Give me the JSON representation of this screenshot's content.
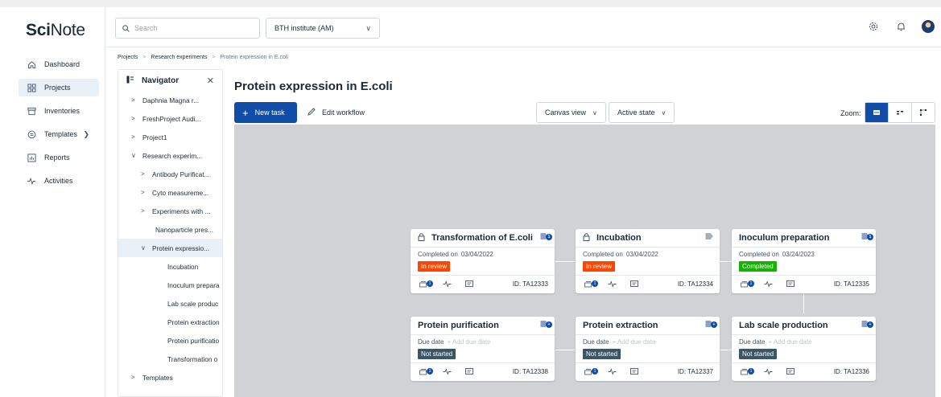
{
  "app": {
    "logo_sci": "Sci",
    "logo_note": "Note"
  },
  "sidebar": {
    "items": [
      {
        "label": "Dashboard",
        "icon": "home-icon"
      },
      {
        "label": "Projects",
        "icon": "projects-icon",
        "active": true
      },
      {
        "label": "Inventories",
        "icon": "inventory-icon"
      },
      {
        "label": "Templates",
        "icon": "templates-icon"
      },
      {
        "label": "Reports",
        "icon": "reports-icon"
      },
      {
        "label": "Activities",
        "icon": "activity-icon"
      }
    ]
  },
  "topbar": {
    "search_placeholder": "Search",
    "team": "BTH institute (AM)"
  },
  "breadcrumb": {
    "projects": "Projects",
    "research": "Research experiments",
    "current": "Protein expression in E.coli"
  },
  "navigator": {
    "title": "Navigator",
    "rows": [
      "Daphnia Magna r...",
      "FreshProject Audi...",
      "Project1",
      "Research experim...",
      "Antibody Purificat...",
      "Cyto measureme...",
      "Experiments with ...",
      "Nanoparticle pres...",
      "Protein expressio...",
      "Incubation",
      "Inoculum prepara",
      "Lab scale produc",
      "Protein extraction",
      "Protein purificatio",
      "Transformation o",
      "Templates"
    ]
  },
  "main": {
    "title": "Protein expression in E.coli",
    "new_task": "New task",
    "edit_workflow": "Edit workflow",
    "canvas_view": "Canvas view",
    "active_state": "Active state",
    "zoom_label": "Zoom:"
  },
  "tasks": [
    {
      "name": "Transformation of E.coli",
      "date_label": "Completed on",
      "date": "03/04/2022",
      "status": "In review",
      "id": "ID: TA12333",
      "locked": true,
      "tag_badge": "1",
      "results": "1"
    },
    {
      "name": "Incubation",
      "date_label": "Completed on",
      "date": "03/04/2022",
      "status": "In review",
      "id": "ID: TA12334",
      "locked": true,
      "tag_badge": "",
      "results": "1"
    },
    {
      "name": "Inoculum preparation",
      "date_label": "Completed on",
      "date": "03/24/2023",
      "status": "Completed",
      "id": "ID: TA12335",
      "locked": false,
      "tag_badge": "1",
      "results": "1"
    },
    {
      "name": "Protein purification",
      "date_label": "Due date",
      "date": "+ Add due date",
      "status": "Not started",
      "id": "ID: TA12338",
      "locked": false,
      "tag_badge": "+",
      "results": "1"
    },
    {
      "name": "Protein extraction",
      "date_label": "Due date",
      "date": "+ Add due date",
      "status": "Not started",
      "id": "ID: TA12337",
      "locked": false,
      "tag_badge": "+",
      "results": "1"
    },
    {
      "name": "Lab scale production",
      "date_label": "Due date",
      "date": "+ Add due date",
      "status": "Not started",
      "id": "ID: TA12336",
      "locked": false,
      "tag_badge": "+",
      "results": "1"
    }
  ],
  "colors": {
    "primary": "#104da9",
    "in_review": "#ff4500",
    "completed": "#15b300",
    "not_started": "#3a5566",
    "canvas": "#d0d2d6"
  }
}
